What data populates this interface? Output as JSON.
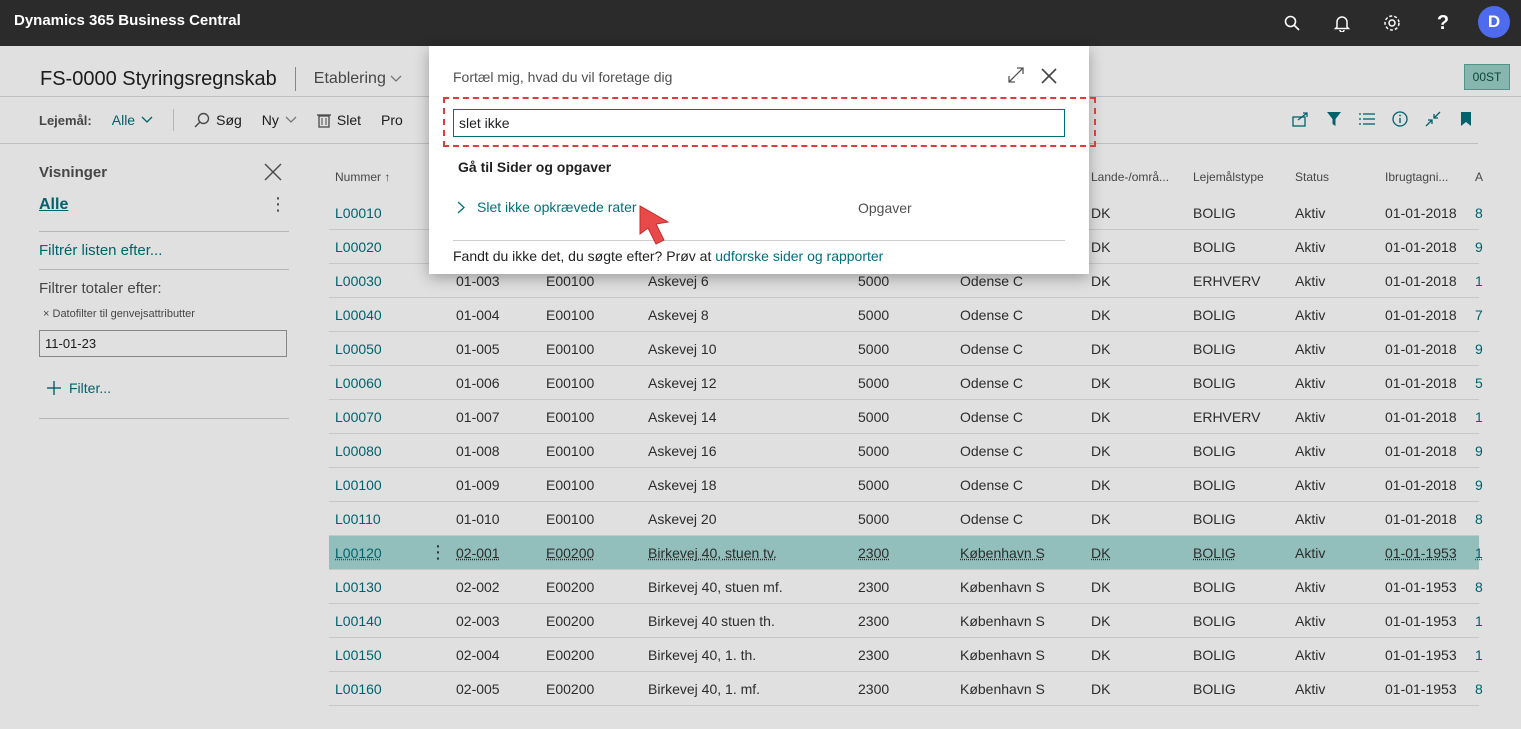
{
  "app": {
    "title": "Dynamics 365 Business Central",
    "user_initial": "D"
  },
  "topbar_icons": [
    "search-icon",
    "bell-icon",
    "gear-icon",
    "help-icon"
  ],
  "page": {
    "title": "FS-0000 Styringsregnskab",
    "menu": "Etablering",
    "badge": "00ST"
  },
  "actions": {
    "filter_label": "Lejemål:",
    "filter_value": "Alle",
    "search": "Søg",
    "new": "Ny",
    "delete": "Slet",
    "process": "Pro"
  },
  "sidebar": {
    "title": "Visninger",
    "all": "Alle",
    "filter_list": "Filtrér listen efter...",
    "filter_totals": "Filtrer totaler efter:",
    "date_filter_label": "Datofilter til genvejsattributter",
    "date_filter_value": "11-01-23",
    "add_filter": "Filter..."
  },
  "table": {
    "headers": [
      "Nummer",
      "",
      "",
      "",
      "",
      "",
      "Lande-/områ...",
      "Lejemålstype",
      "Status",
      "Ibrugtagni...",
      "A"
    ],
    "rows": [
      [
        "L00010",
        "",
        "",
        "",
        "",
        "",
        "DK",
        "BOLIG",
        "Aktiv",
        "01-01-2018",
        "8"
      ],
      [
        "L00020",
        "",
        "",
        "",
        "",
        "",
        "DK",
        "BOLIG",
        "Aktiv",
        "01-01-2018",
        "9"
      ],
      [
        "L00030",
        "01-003",
        "E00100",
        "Askevej 6",
        "5000",
        "Odense C",
        "DK",
        "ERHVERV",
        "Aktiv",
        "01-01-2018",
        "1"
      ],
      [
        "L00040",
        "01-004",
        "E00100",
        "Askevej 8",
        "5000",
        "Odense C",
        "DK",
        "BOLIG",
        "Aktiv",
        "01-01-2018",
        "7"
      ],
      [
        "L00050",
        "01-005",
        "E00100",
        "Askevej 10",
        "5000",
        "Odense C",
        "DK",
        "BOLIG",
        "Aktiv",
        "01-01-2018",
        "9"
      ],
      [
        "L00060",
        "01-006",
        "E00100",
        "Askevej 12",
        "5000",
        "Odense C",
        "DK",
        "BOLIG",
        "Aktiv",
        "01-01-2018",
        "5"
      ],
      [
        "L00070",
        "01-007",
        "E00100",
        "Askevej 14",
        "5000",
        "Odense C",
        "DK",
        "ERHVERV",
        "Aktiv",
        "01-01-2018",
        "1"
      ],
      [
        "L00080",
        "01-008",
        "E00100",
        "Askevej 16",
        "5000",
        "Odense C",
        "DK",
        "BOLIG",
        "Aktiv",
        "01-01-2018",
        "9"
      ],
      [
        "L00100",
        "01-009",
        "E00100",
        "Askevej 18",
        "5000",
        "Odense C",
        "DK",
        "BOLIG",
        "Aktiv",
        "01-01-2018",
        "9"
      ],
      [
        "L00110",
        "01-010",
        "E00100",
        "Askevej 20",
        "5000",
        "Odense C",
        "DK",
        "BOLIG",
        "Aktiv",
        "01-01-2018",
        "8"
      ],
      [
        "L00120",
        "02-001",
        "E00200",
        "Birkevej 40, stuen tv.",
        "2300",
        "København S",
        "DK",
        "BOLIG",
        "Aktiv",
        "01-01-1953",
        "1"
      ],
      [
        "L00130",
        "02-002",
        "E00200",
        "Birkevej 40, stuen mf.",
        "2300",
        "København S",
        "DK",
        "BOLIG",
        "Aktiv",
        "01-01-1953",
        "8"
      ],
      [
        "L00140",
        "02-003",
        "E00200",
        "Birkevej 40 stuen th.",
        "2300",
        "København S",
        "DK",
        "BOLIG",
        "Aktiv",
        "01-01-1953",
        "1"
      ],
      [
        "L00150",
        "02-004",
        "E00200",
        "Birkevej 40, 1. th.",
        "2300",
        "København S",
        "DK",
        "BOLIG",
        "Aktiv",
        "01-01-1953",
        "1"
      ],
      [
        "L00160",
        "02-005",
        "E00200",
        "Birkevej 40, 1. mf.",
        "2300",
        "København S",
        "DK",
        "BOLIG",
        "Aktiv",
        "01-01-1953",
        "8"
      ]
    ],
    "selected_index": 10
  },
  "dialog": {
    "title": "Fortæl mig, hvad du vil foretage dig",
    "search_value": "slet ikke",
    "section": "Gå til Sider og opgaver",
    "result_label": "Slet ikke opkrævede rater",
    "result_category": "Opgaver",
    "footer_text": "Fandt du ikke det, du søgte efter? Prøv at ",
    "footer_link": "udforske sider og rapporter"
  },
  "colors": {
    "accent": "#00707a",
    "topbar": "#2b2b2b",
    "selected_row": "#a7dad6",
    "highlight": "#e03a3a"
  }
}
